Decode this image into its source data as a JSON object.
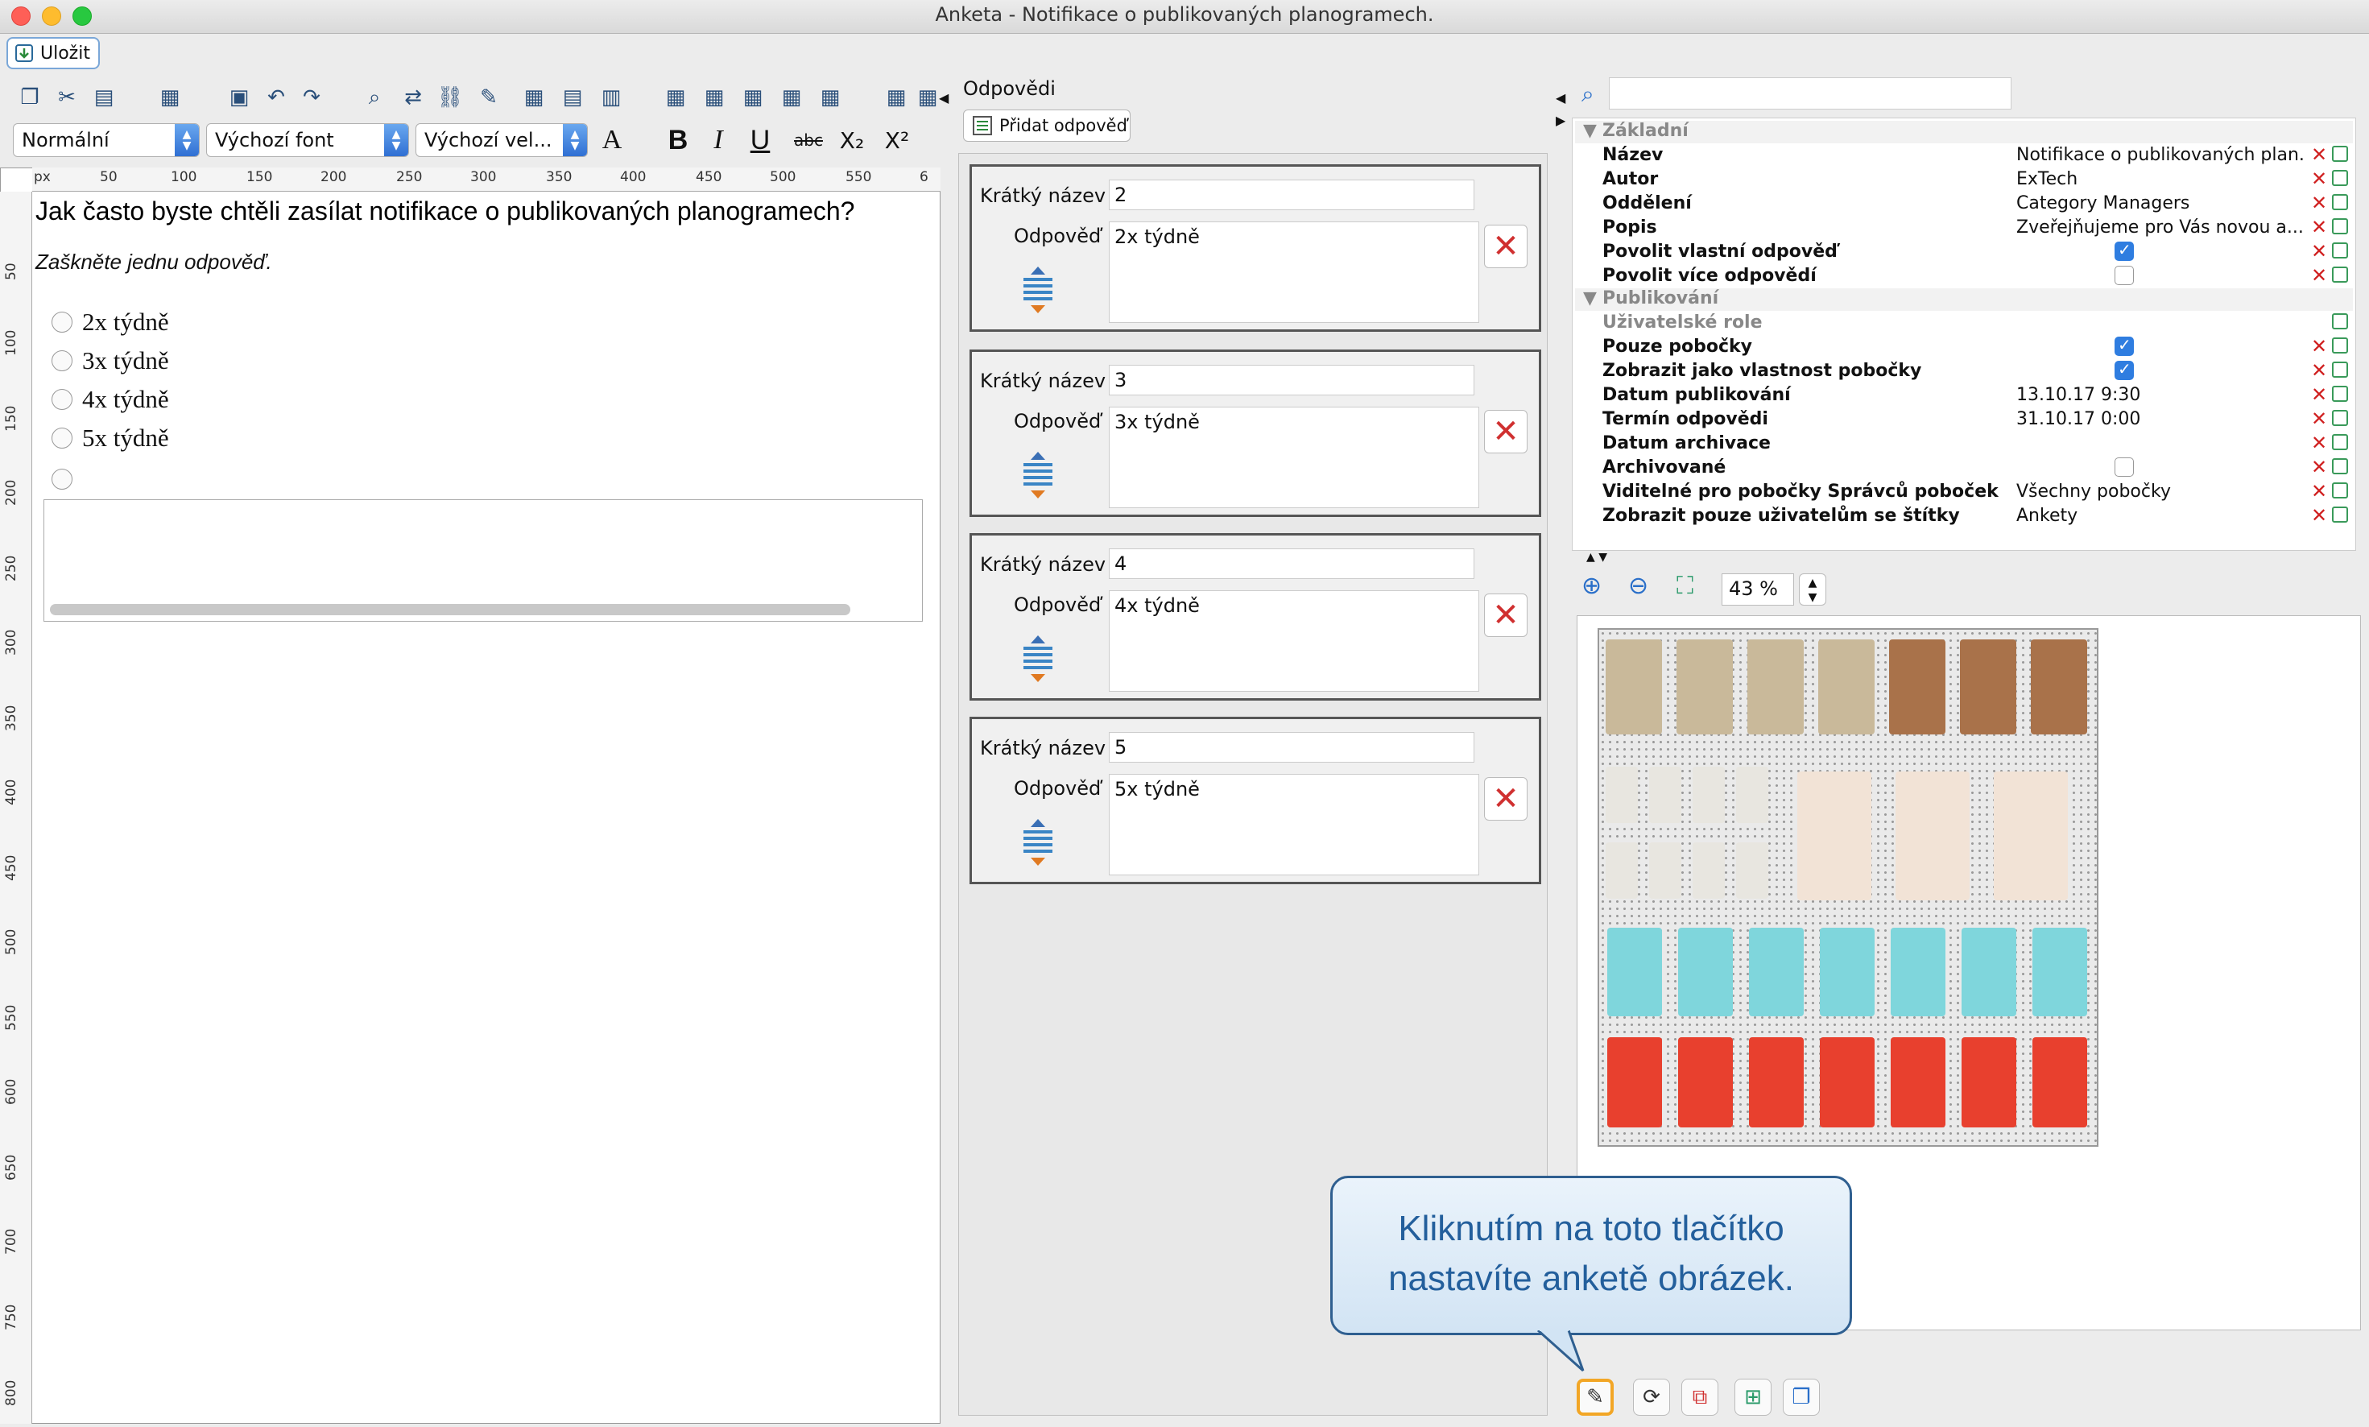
{
  "window": {
    "title": "Anketa - Notifikace o publikovaných planogramech."
  },
  "toolbar": {
    "save_label": "Uložit",
    "zoom_value": "43 %"
  },
  "format": {
    "style": "Normální",
    "font": "Výchozí font",
    "size": "Výchozí vel...",
    "bold": "B",
    "italic": "I",
    "underline": "U",
    "strike": "abc",
    "sub": "X₂",
    "sup": "X²"
  },
  "ruler": {
    "unit": "px",
    "h_ticks": [
      "50",
      "100",
      "150",
      "200",
      "250",
      "300",
      "350",
      "400",
      "450",
      "500",
      "550",
      "6"
    ],
    "v_ticks": [
      "50",
      "100",
      "150",
      "200",
      "250",
      "300",
      "350",
      "400",
      "450",
      "500",
      "550",
      "600",
      "650",
      "700",
      "750",
      "800"
    ]
  },
  "editor": {
    "question": "Jak často byste chtěli zasílat notifikace o publikovaných planogramech?",
    "instruction": "Zaškněte jednu odpověď.",
    "options": [
      "2x týdně",
      "3x týdně",
      "4x týdně",
      "5x týdně"
    ]
  },
  "answers": {
    "title": "Odpovědi",
    "add_label": "Přidat odpověď",
    "short_name_label": "Krátký název",
    "answer_label": "Odpověď",
    "items": [
      {
        "short": "2",
        "text": "2x týdně"
      },
      {
        "short": "3",
        "text": "3x týdně"
      },
      {
        "short": "4",
        "text": "4x týdně"
      },
      {
        "short": "5",
        "text": "5x týdně"
      }
    ]
  },
  "properties": {
    "sections": {
      "basic": "Základní",
      "publishing": "Publikování"
    },
    "rows": [
      {
        "key": "Název",
        "value": "Notifikace o publikovaných plan..."
      },
      {
        "key": "Autor",
        "value": "ExTech"
      },
      {
        "key": "Oddělení",
        "value": "Category Managers"
      },
      {
        "key": "Popis",
        "value": "Zveřejňujeme pro Vás novou a..."
      },
      {
        "key": "Povolit vlastní odpověď",
        "value": ""
      },
      {
        "key": "Povolit více odpovědí",
        "value": ""
      },
      {
        "key": "Uživatelské role",
        "value": ""
      },
      {
        "key": "Pouze pobočky",
        "value": ""
      },
      {
        "key": "Zobrazit jako vlastnost pobočky",
        "value": ""
      },
      {
        "key": "Datum publikování",
        "value": "13.10.17 9:30"
      },
      {
        "key": "Termín odpovědi",
        "value": "31.10.17 0:00"
      },
      {
        "key": "Datum archivace",
        "value": ""
      },
      {
        "key": "Archivované",
        "value": ""
      },
      {
        "key": "Viditelné pro pobočky Správců poboček",
        "value": "Všechny pobočky"
      },
      {
        "key": "Zobrazit pouze uživatelům se štítky",
        "value": "Ankety"
      }
    ]
  },
  "callout": {
    "line1": "Kliknutím na toto tlačítko",
    "line2": "nastavíte anketě obrázek."
  },
  "colors": {
    "accent": "#2f7de0",
    "callout_text": "#235f9c",
    "highlight": "#f2a626",
    "delete": "#d03030"
  }
}
